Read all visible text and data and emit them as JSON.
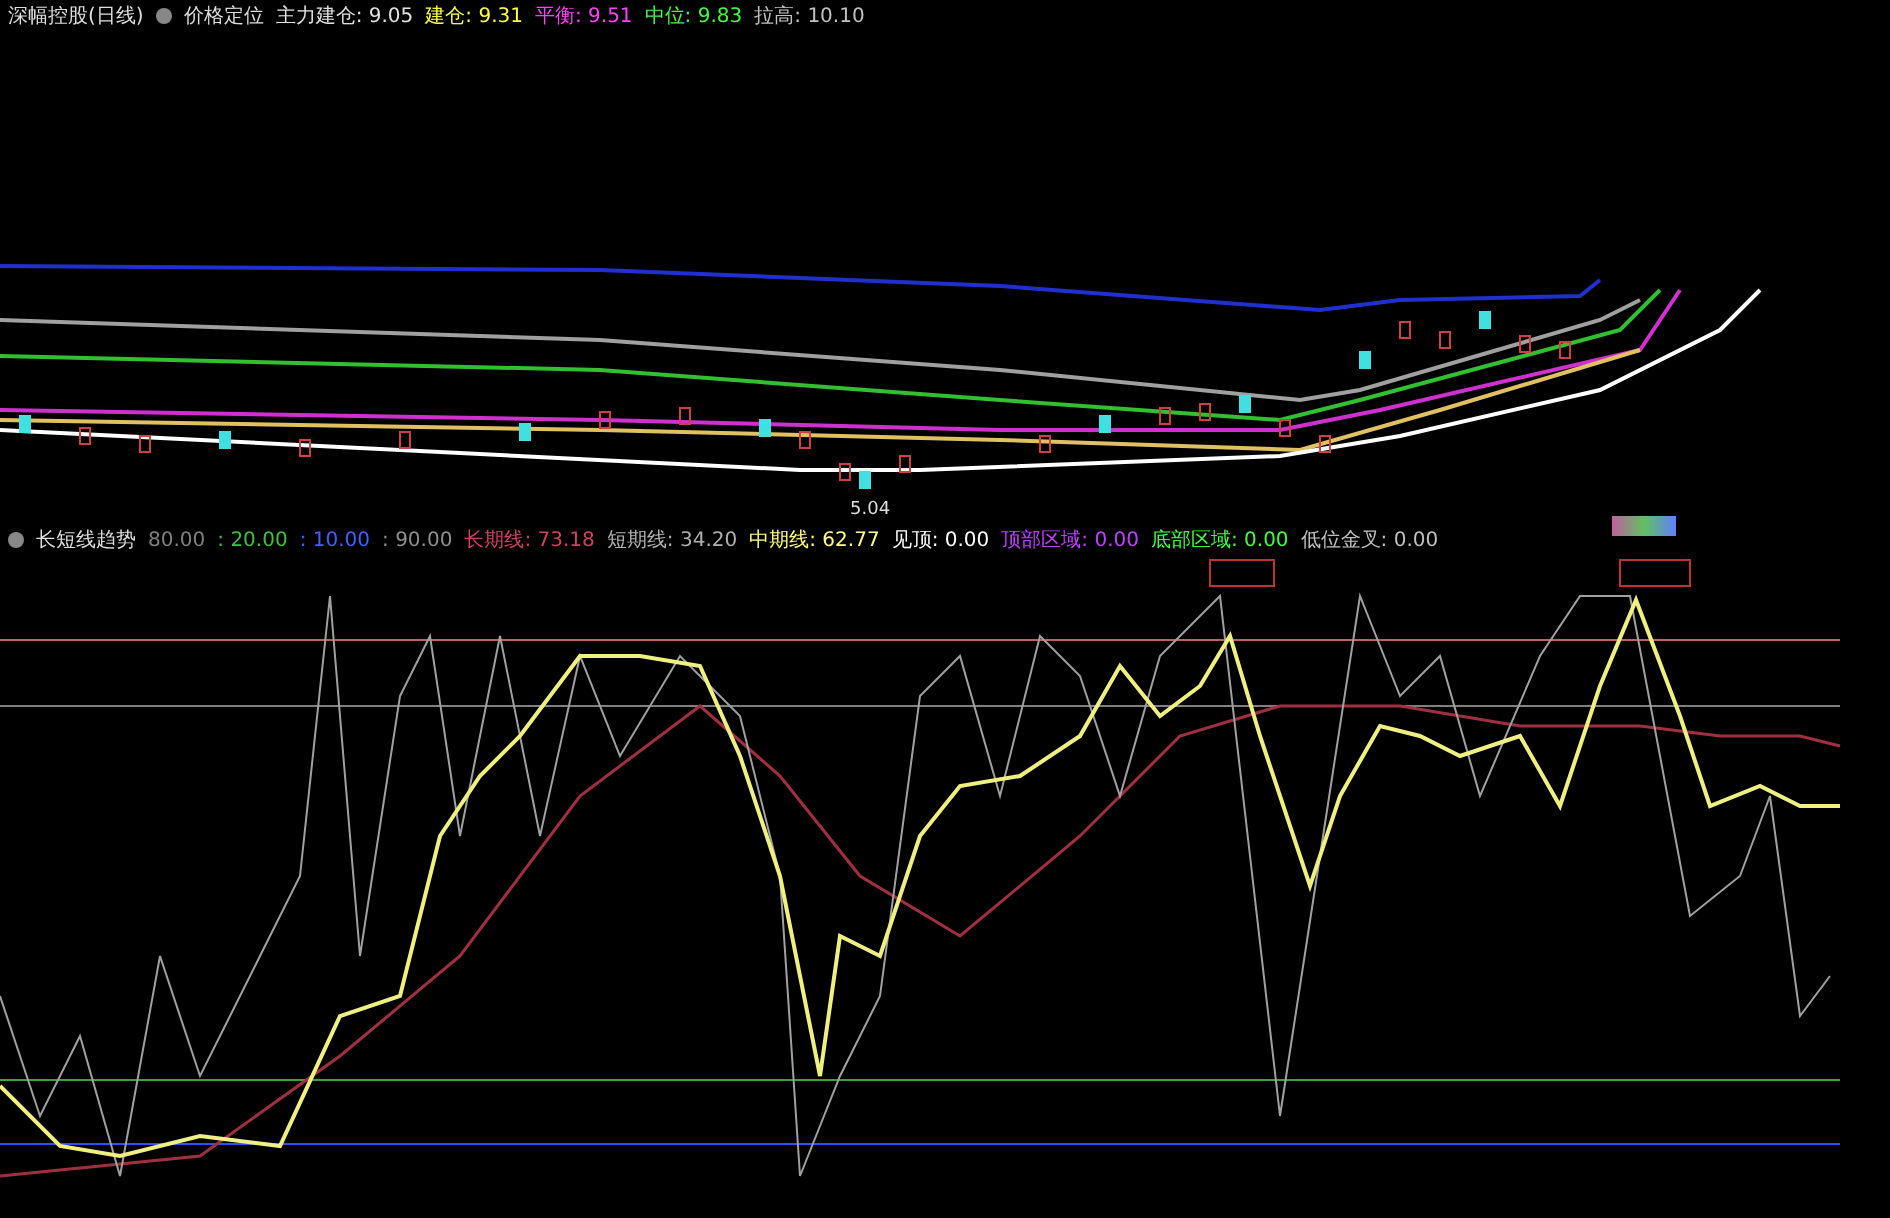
{
  "main_chart": {
    "title": "深幅控股(日线)",
    "indicator": "价格定位",
    "readings": [
      {
        "label": "主力建仓:",
        "value": "9.05",
        "color": "#e0e0e0"
      },
      {
        "label": "建仓:",
        "value": "9.31",
        "color": "#ffff40"
      },
      {
        "label": "平衡:",
        "value": "9.51",
        "color": "#ff40ff"
      },
      {
        "label": "中位:",
        "value": "9.83",
        "color": "#40ff40"
      },
      {
        "label": "拉高:",
        "value": "10.10",
        "color": "#c0c0c0"
      }
    ],
    "low_label": "5.04"
  },
  "sub_chart": {
    "title": "长短线趋势",
    "params": [
      {
        "text": "80.00",
        "color": "#808080"
      },
      {
        "text": ": 20.00",
        "color": "#40c040"
      },
      {
        "text": ": 10.00",
        "color": "#4060ff"
      },
      {
        "text": ": 90.00",
        "color": "#909090"
      }
    ],
    "readings": [
      {
        "label": "长期线:",
        "value": "73.18",
        "color": "#d04060"
      },
      {
        "label": "短期线:",
        "value": "34.20",
        "color": "#b0b0b0"
      },
      {
        "label": "中期线:",
        "value": "62.77",
        "color": "#ffff80"
      },
      {
        "label": "见顶:",
        "value": "0.00",
        "color": "#ffffff"
      },
      {
        "label": "顶部区域:",
        "value": "0.00",
        "color": "#c040ff"
      },
      {
        "label": "底部区域:",
        "value": "0.00",
        "color": "#40ff40"
      },
      {
        "label": "低位金叉:",
        "value": "0.00",
        "color": "#c0c0c0"
      }
    ]
  }
}
